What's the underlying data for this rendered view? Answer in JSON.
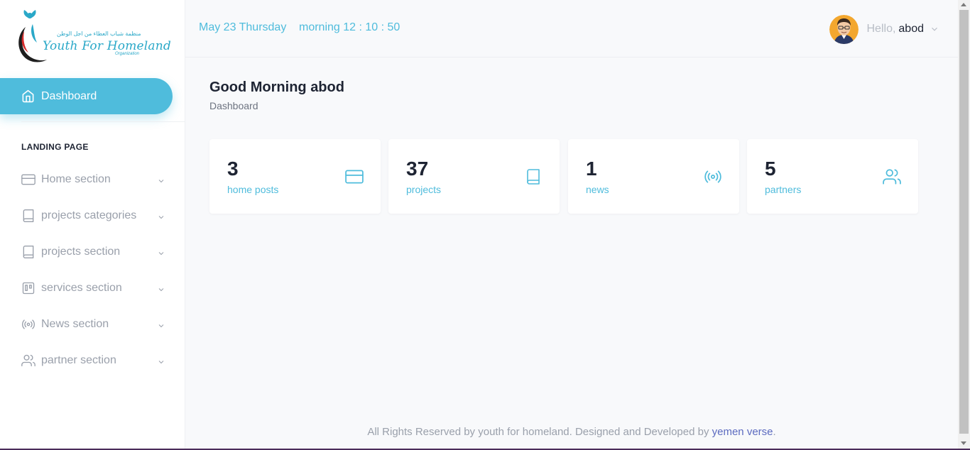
{
  "brand": {
    "name": "Youth For Homeland",
    "arabic": "منظمة شباب العطاء من اجل الوطن",
    "subtitle": "Organization"
  },
  "sidebar": {
    "active_item": {
      "label": "Dashboard",
      "icon": "home-icon"
    },
    "section_heading": "LANDING PAGE",
    "items": [
      {
        "label": "Home section",
        "icon": "credit-card-icon"
      },
      {
        "label": "projects categories",
        "icon": "book-icon"
      },
      {
        "label": "projects section",
        "icon": "book-icon"
      },
      {
        "label": "services section",
        "icon": "trello-icon"
      },
      {
        "label": "News section",
        "icon": "radio-icon"
      },
      {
        "label": "partner section",
        "icon": "users-icon"
      }
    ]
  },
  "header": {
    "date": "May 23 Thursday",
    "time": "morning 12 : 10 : 50",
    "greeting_prefix": "Hello,",
    "username": "abod"
  },
  "main": {
    "greeting": "Good Morning abod",
    "breadcrumb": "Dashboard",
    "cards": [
      {
        "value": "3",
        "label": "home posts",
        "icon": "credit-card-icon"
      },
      {
        "value": "37",
        "label": "projects",
        "icon": "book-icon"
      },
      {
        "value": "1",
        "label": "news",
        "icon": "radio-icon"
      },
      {
        "value": "5",
        "label": "partners",
        "icon": "users-icon"
      }
    ]
  },
  "footer": {
    "text": "All Rights Reserved by youth for homeland. Designed and Developed by",
    "link": "yemen verse",
    "end": "."
  },
  "colors": {
    "accent": "#4fbcdc",
    "text_dark": "#1e2433",
    "text_muted": "#9aa0ab",
    "link": "#5c6bc0"
  }
}
